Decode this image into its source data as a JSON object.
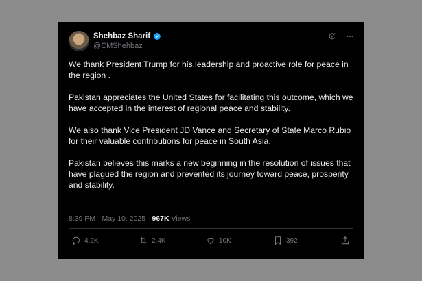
{
  "author": {
    "name": "Shehbaz Sharif",
    "handle": "@CMShehbaz"
  },
  "tweet": {
    "paragraphs": [
      "We thank President Trump for his leadership and proactive role for peace in the region .",
      "Pakistan appreciates the United States for facilitating this outcome, which we have accepted in the interest of regional peace and stability.",
      "We also thank Vice President JD Vance and Secretary of State Marco Rubio for their valuable contributions for peace in South Asia.",
      "Pakistan believes this marks a new beginning in the resolution of issues that have plagued the region and prevented its journey toward peace, prosperity and stability."
    ]
  },
  "meta": {
    "time": "8:39 PM",
    "separator": "·",
    "date": "May 10, 2025",
    "views_count": "967K",
    "views_label": "Views"
  },
  "actions": {
    "replies": "4.2K",
    "reposts": "2.4K",
    "likes": "10K",
    "bookmarks": "392"
  },
  "icons": {
    "verified": "verified-badge-icon",
    "grok": "grok-icon",
    "more": "more-icon",
    "reply": "reply-icon",
    "repost": "repost-icon",
    "like": "heart-icon",
    "bookmark": "bookmark-icon",
    "share": "share-icon"
  },
  "colors": {
    "background": "#000000",
    "text": "#e7e9ea",
    "muted": "#71767b",
    "verified": "#1d9bf0",
    "divider": "#2f3336"
  }
}
